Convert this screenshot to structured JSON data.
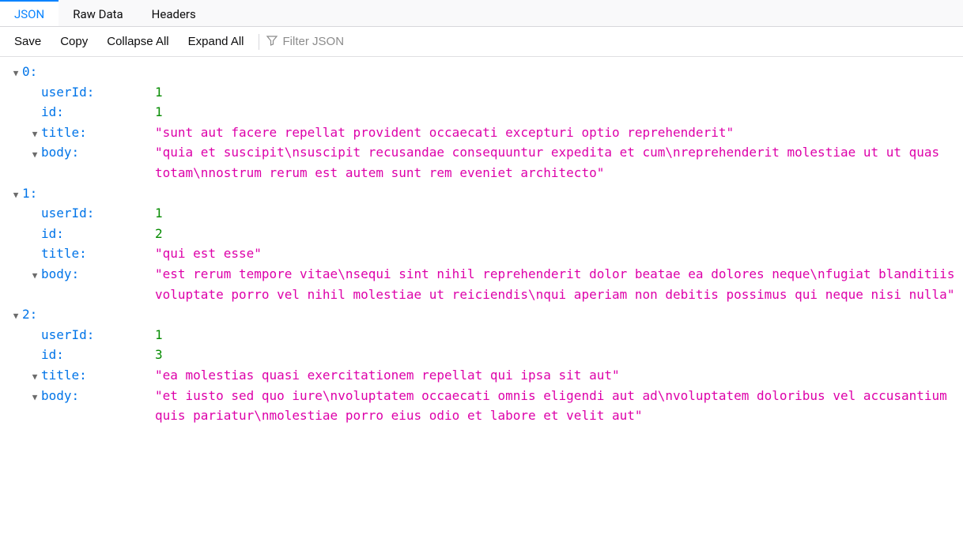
{
  "tabs": {
    "json": "JSON",
    "raw": "Raw Data",
    "headers": "Headers"
  },
  "toolbar": {
    "save": "Save",
    "copy": "Copy",
    "collapse": "Collapse All",
    "expand": "Expand All",
    "filter_placeholder": "Filter JSON"
  },
  "tree": [
    {
      "index": "0",
      "userId": {
        "key": "userId",
        "value": "1"
      },
      "id": {
        "key": "id",
        "value": "1"
      },
      "title": {
        "key": "title",
        "value": "\"sunt aut facere repellat provident occaecati excepturi optio reprehenderit\""
      },
      "body": {
        "key": "body",
        "value": "\"quia et suscipit\\nsuscipit recusandae consequuntur expedita et cum\\nreprehenderit molestiae ut ut quas totam\\nnostrum rerum est autem sunt rem eveniet architecto\""
      }
    },
    {
      "index": "1",
      "userId": {
        "key": "userId",
        "value": "1"
      },
      "id": {
        "key": "id",
        "value": "2"
      },
      "title": {
        "key": "title",
        "value": "\"qui est esse\""
      },
      "body": {
        "key": "body",
        "value": "\"est rerum tempore vitae\\nsequi sint nihil reprehenderit dolor beatae ea dolores neque\\nfugiat blanditiis voluptate porro vel nihil molestiae ut reiciendis\\nqui aperiam non debitis possimus qui neque nisi nulla\""
      }
    },
    {
      "index": "2",
      "userId": {
        "key": "userId",
        "value": "1"
      },
      "id": {
        "key": "id",
        "value": "3"
      },
      "title": {
        "key": "title",
        "value": "\"ea molestias quasi exercitationem repellat qui ipsa sit aut\""
      },
      "body": {
        "key": "body",
        "value": "\"et iusto sed quo iure\\nvoluptatem occaecati omnis eligendi aut ad\\nvoluptatem doloribus vel accusantium quis pariatur\\nmolestiae porro eius odio et labore et velit aut\""
      }
    }
  ],
  "row1_title_expanded": true,
  "row2_title_expanded": false,
  "row3_title_expanded": true
}
